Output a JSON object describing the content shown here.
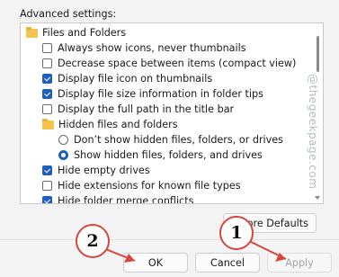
{
  "advanced_settings_label": "Advanced settings:",
  "tree": [
    {
      "type": "folder",
      "label": "Files and Folders",
      "icon": "folder-icon"
    },
    {
      "type": "checkbox",
      "label": "Always show icons, never thumbnails",
      "checked": false
    },
    {
      "type": "checkbox",
      "label": "Decrease space between items (compact view)",
      "checked": false
    },
    {
      "type": "checkbox",
      "label": "Display file icon on thumbnails",
      "checked": true
    },
    {
      "type": "checkbox",
      "label": "Display file size information in folder tips",
      "checked": true
    },
    {
      "type": "checkbox",
      "label": "Display the full path in the title bar",
      "checked": false
    },
    {
      "type": "folder",
      "label": "Hidden files and folders",
      "icon": "folder-icon"
    },
    {
      "type": "radio",
      "label": "Don’t show hidden files, folders, or drives",
      "checked": false
    },
    {
      "type": "radio",
      "label": "Show hidden files, folders, and drives",
      "checked": true
    },
    {
      "type": "checkbox",
      "label": "Hide empty drives",
      "checked": true
    },
    {
      "type": "checkbox",
      "label": "Hide extensions for known file types",
      "checked": false
    },
    {
      "type": "checkbox",
      "label": "Hide folder merge conflicts",
      "checked": true
    }
  ],
  "watermark": "@thegeekpage.com",
  "buttons": {
    "restore_defaults": "tore Defaults",
    "ok": "OK",
    "cancel": "Cancel",
    "apply": "Apply"
  },
  "annotations": {
    "badge_1": "1",
    "badge_2": "2",
    "color": "#d6463d"
  }
}
